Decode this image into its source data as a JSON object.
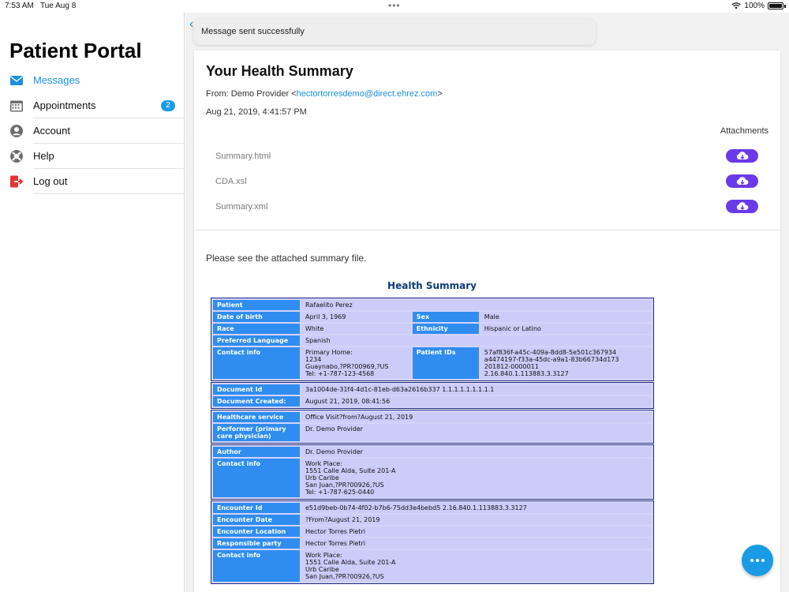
{
  "status": {
    "time": "7:53 AM",
    "date": "Tue Aug 8",
    "battery": "100%"
  },
  "sidebar": {
    "title": "Patient Portal",
    "items": [
      {
        "label": "Messages",
        "icon": "envelope-icon",
        "active": true
      },
      {
        "label": "Appointments",
        "icon": "calendar-icon",
        "badge": "2"
      },
      {
        "label": "Account",
        "icon": "user-icon"
      },
      {
        "label": "Help",
        "icon": "lifebuoy-icon"
      },
      {
        "label": "Log out",
        "icon": "logout-icon"
      }
    ]
  },
  "toast": {
    "text": "Message sent successfully"
  },
  "message": {
    "title": "Your Health Summary",
    "from_prefix": "From: Demo Provider <",
    "from_email": "hectortorresdemo@direct.ehrez.com",
    "from_suffix": ">",
    "date": "Aug 21, 2019, 4:41:57 PM",
    "attachments_label": "Attachments",
    "attachments": [
      "Summary.html",
      "CDA.xsl",
      "Summary.xml"
    ],
    "body": "Please see the attached summary file."
  },
  "summary": {
    "title": "Health Summary",
    "patient": {
      "patient_label": "Patient",
      "patient_value": "Rafaelito Perez",
      "dob_label": "Date of birth",
      "dob_value": "April 3, 1969",
      "sex_label": "Sex",
      "sex_value": "Male",
      "race_label": "Race",
      "race_value": "White",
      "ethnicity_label": "Ethnicity",
      "ethnicity_value": "Hispanic or Latino",
      "lang_label": "Preferred Language",
      "lang_value": "Spanish",
      "contact_label": "Contact info",
      "contact_value": "Primary Home:\n1234\nGuaynabo,?PR?00969,?US\nTel: +1-787-123-4568",
      "ids_label": "Patient IDs",
      "ids_value": "57af836f-a45c-409a-8dd8-5e501c367934\na4474197-f33a-45dc-a9a1-83b66734d173\n201812-0000011\n2.16.840.1.113883.3.3127"
    },
    "document": {
      "id_label": "Document Id",
      "id_value": "3a1004de-31f4-4d1c-81eb-d63a2616b337 1.1.1.1.1.1.1.1.1",
      "created_label": "Document Created:",
      "created_value": "August 21, 2019, 08:41:56"
    },
    "service": {
      "service_label": "Healthcare service",
      "service_value": "Office Visit?from?August 21, 2019",
      "performer_label": "Performer (primary care physician)",
      "performer_value": "Dr. Demo Provider"
    },
    "author": {
      "author_label": "Author",
      "author_value": "Dr. Demo Provider",
      "contact_label": "Contact info",
      "contact_value": "Work Place:\n1551 Calle Alda, Suite 201-A\nUrb Caribe\nSan Juan,?PR?00926,?US\nTel: +1-787-625-0440"
    },
    "encounter": {
      "id_label": "Encounter Id",
      "id_value": "e51d9beb-0b74-4f02-b7b6-75dd3e4bebd5 2.16.840.1.113883.3.3127",
      "date_label": "Encounter Date",
      "date_value": "?From?August 21, 2019",
      "location_label": "Encounter Location",
      "location_value": "Hector Torres Pietri",
      "party_label": "Responsible party",
      "party_value": "Hector Torres Pietri",
      "contact_label": "Contact info",
      "contact_value": "Work Place:\n1551 Calle Alda, Suite 201-A\nUrb Caribe\nSan Juan,?PR?00926,?US"
    }
  },
  "fab": {
    "icon": "more-icon"
  }
}
